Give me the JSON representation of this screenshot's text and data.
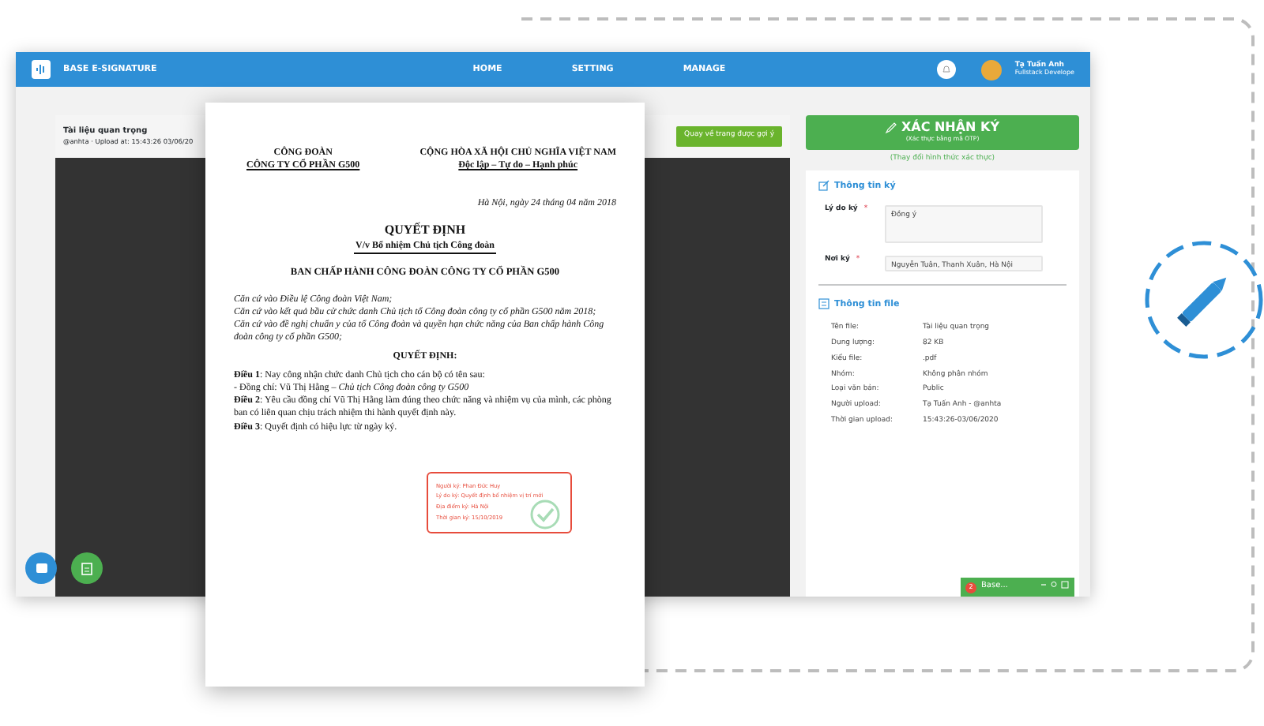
{
  "navbar": {
    "brand": "BASE E-SIGNATURE",
    "links": [
      {
        "label": "HOME"
      },
      {
        "label": "SETTING"
      },
      {
        "label": "MANAGE"
      }
    ],
    "user": {
      "name": "Tạ Tuấn Anh",
      "role": "Fullstack Develope"
    }
  },
  "document_header": {
    "title": "Tài liệu quan trọng",
    "subtitle": "@anhta · Upload at: 15:43:26 03/06/20",
    "button": "Quay về trang được gợi ý"
  },
  "document_page": {
    "left_header": [
      "CÔNG ĐOÀN",
      "CÔNG TY CỔ PHẦN G500"
    ],
    "right_header": [
      "CỘNG HÒA XÃ HỘI CHỦ NGHĨA VIỆT NAM",
      "Độc lập – Tự do – Hạnh phúc"
    ],
    "date": "Hà Nội, ngày 24 tháng 04 năm 2018",
    "title": "QUYẾT ĐỊNH",
    "subject": "V/v Bổ nhiệm Chủ tịch Công đoàn",
    "issuer": "BAN CHẤP HÀNH  CÔNG ĐOÀN CÔNG TY CỔ PHẦN G500",
    "grounds": [
      "Căn cứ vào Điều lệ Công đoàn Việt Nam;",
      "Căn cứ vào kết quả bầu cử chức danh Chủ tịch tổ Công đoàn công ty cổ phần G500 năm 2018;",
      "Căn cứ vào đề nghị chuẩn y của tổ Công đoàn và quyền hạn chức năng của Ban chấp hành Công đoàn công ty cổ phần G500;"
    ],
    "decision_title": "QUYẾT ĐỊNH:",
    "articles": [
      "**Điều 1**: Nay công nhận chức danh Chủ tịch cho cán bộ có tên sau:",
      "- Đồng chí: Vũ Thị Hằng – *Chủ tịch Công đoàn công ty G500*",
      "**Điều 2**: Yêu cầu đồng chí Vũ Thị Hằng làm đúng theo chức năng và nhiệm vụ của mình, các phòng ban có liên quan chịu trách nhiệm thi hành quyết định này.",
      "**Điều 3**: Quyết định có hiệu lực từ ngày ký."
    ],
    "signature_stamp": [
      "Người ký: Phan Đức Huy",
      "Lý do ký: Quyết định bổ nhiệm vị trí mới",
      "Địa điểm ký: Hà Nội",
      "Thời gian ký: 15/10/2019"
    ]
  },
  "sign_panel": {
    "confirm_button": {
      "label": "XÁC NHẬN KÝ",
      "sublabel": "(Xác thực bằng mã OTP)"
    },
    "change_link": "(Thay đổi hình thức xác thực)",
    "sign_info": {
      "title": "Thông tin ký",
      "fields": [
        {
          "label": "Lý do ký",
          "mark": "*",
          "value": "Đồng ý",
          "kind": "textarea"
        },
        {
          "label": "Nơi ký",
          "mark": "*",
          "value": "Nguyễn Tuân, Thanh Xuân, Hà Nội",
          "kind": "input"
        }
      ]
    },
    "file_info": {
      "title": "Thông tin file",
      "rows": [
        {
          "label": "Tên file:",
          "value": "Tài liệu quan trọng"
        },
        {
          "label": "Dung lượng:",
          "value": "82 KB"
        },
        {
          "label": "Kiểu file:",
          "value": ".pdf"
        },
        {
          "label": "Nhóm:",
          "value": "Không phân nhóm"
        },
        {
          "label": "Loại văn bản:",
          "value": "Public"
        },
        {
          "label": "Người upload:",
          "value": "Tạ Tuấn Anh - @anhta"
        },
        {
          "label": "Thời gian upload:",
          "value": "15:43:26-03/06/2020"
        }
      ]
    }
  },
  "chat_widget": {
    "badge": "2",
    "label": "Base..."
  }
}
